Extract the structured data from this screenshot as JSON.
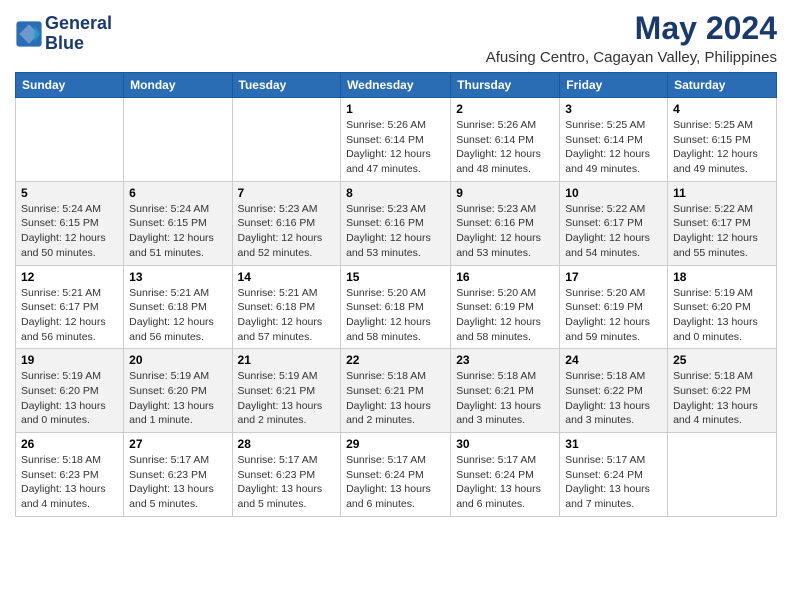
{
  "header": {
    "logo_line1": "General",
    "logo_line2": "Blue",
    "main_title": "May 2024",
    "subtitle": "Afusing Centro, Cagayan Valley, Philippines"
  },
  "weekdays": [
    "Sunday",
    "Monday",
    "Tuesday",
    "Wednesday",
    "Thursday",
    "Friday",
    "Saturday"
  ],
  "weeks": [
    [
      {
        "day": "",
        "content": ""
      },
      {
        "day": "",
        "content": ""
      },
      {
        "day": "",
        "content": ""
      },
      {
        "day": "1",
        "content": "Sunrise: 5:26 AM\nSunset: 6:14 PM\nDaylight: 12 hours\nand 47 minutes."
      },
      {
        "day": "2",
        "content": "Sunrise: 5:26 AM\nSunset: 6:14 PM\nDaylight: 12 hours\nand 48 minutes."
      },
      {
        "day": "3",
        "content": "Sunrise: 5:25 AM\nSunset: 6:14 PM\nDaylight: 12 hours\nand 49 minutes."
      },
      {
        "day": "4",
        "content": "Sunrise: 5:25 AM\nSunset: 6:15 PM\nDaylight: 12 hours\nand 49 minutes."
      }
    ],
    [
      {
        "day": "5",
        "content": "Sunrise: 5:24 AM\nSunset: 6:15 PM\nDaylight: 12 hours\nand 50 minutes."
      },
      {
        "day": "6",
        "content": "Sunrise: 5:24 AM\nSunset: 6:15 PM\nDaylight: 12 hours\nand 51 minutes."
      },
      {
        "day": "7",
        "content": "Sunrise: 5:23 AM\nSunset: 6:16 PM\nDaylight: 12 hours\nand 52 minutes."
      },
      {
        "day": "8",
        "content": "Sunrise: 5:23 AM\nSunset: 6:16 PM\nDaylight: 12 hours\nand 53 minutes."
      },
      {
        "day": "9",
        "content": "Sunrise: 5:23 AM\nSunset: 6:16 PM\nDaylight: 12 hours\nand 53 minutes."
      },
      {
        "day": "10",
        "content": "Sunrise: 5:22 AM\nSunset: 6:17 PM\nDaylight: 12 hours\nand 54 minutes."
      },
      {
        "day": "11",
        "content": "Sunrise: 5:22 AM\nSunset: 6:17 PM\nDaylight: 12 hours\nand 55 minutes."
      }
    ],
    [
      {
        "day": "12",
        "content": "Sunrise: 5:21 AM\nSunset: 6:17 PM\nDaylight: 12 hours\nand 56 minutes."
      },
      {
        "day": "13",
        "content": "Sunrise: 5:21 AM\nSunset: 6:18 PM\nDaylight: 12 hours\nand 56 minutes."
      },
      {
        "day": "14",
        "content": "Sunrise: 5:21 AM\nSunset: 6:18 PM\nDaylight: 12 hours\nand 57 minutes."
      },
      {
        "day": "15",
        "content": "Sunrise: 5:20 AM\nSunset: 6:18 PM\nDaylight: 12 hours\nand 58 minutes."
      },
      {
        "day": "16",
        "content": "Sunrise: 5:20 AM\nSunset: 6:19 PM\nDaylight: 12 hours\nand 58 minutes."
      },
      {
        "day": "17",
        "content": "Sunrise: 5:20 AM\nSunset: 6:19 PM\nDaylight: 12 hours\nand 59 minutes."
      },
      {
        "day": "18",
        "content": "Sunrise: 5:19 AM\nSunset: 6:20 PM\nDaylight: 13 hours\nand 0 minutes."
      }
    ],
    [
      {
        "day": "19",
        "content": "Sunrise: 5:19 AM\nSunset: 6:20 PM\nDaylight: 13 hours\nand 0 minutes."
      },
      {
        "day": "20",
        "content": "Sunrise: 5:19 AM\nSunset: 6:20 PM\nDaylight: 13 hours\nand 1 minute."
      },
      {
        "day": "21",
        "content": "Sunrise: 5:19 AM\nSunset: 6:21 PM\nDaylight: 13 hours\nand 2 minutes."
      },
      {
        "day": "22",
        "content": "Sunrise: 5:18 AM\nSunset: 6:21 PM\nDaylight: 13 hours\nand 2 minutes."
      },
      {
        "day": "23",
        "content": "Sunrise: 5:18 AM\nSunset: 6:21 PM\nDaylight: 13 hours\nand 3 minutes."
      },
      {
        "day": "24",
        "content": "Sunrise: 5:18 AM\nSunset: 6:22 PM\nDaylight: 13 hours\nand 3 minutes."
      },
      {
        "day": "25",
        "content": "Sunrise: 5:18 AM\nSunset: 6:22 PM\nDaylight: 13 hours\nand 4 minutes."
      }
    ],
    [
      {
        "day": "26",
        "content": "Sunrise: 5:18 AM\nSunset: 6:23 PM\nDaylight: 13 hours\nand 4 minutes."
      },
      {
        "day": "27",
        "content": "Sunrise: 5:17 AM\nSunset: 6:23 PM\nDaylight: 13 hours\nand 5 minutes."
      },
      {
        "day": "28",
        "content": "Sunrise: 5:17 AM\nSunset: 6:23 PM\nDaylight: 13 hours\nand 5 minutes."
      },
      {
        "day": "29",
        "content": "Sunrise: 5:17 AM\nSunset: 6:24 PM\nDaylight: 13 hours\nand 6 minutes."
      },
      {
        "day": "30",
        "content": "Sunrise: 5:17 AM\nSunset: 6:24 PM\nDaylight: 13 hours\nand 6 minutes."
      },
      {
        "day": "31",
        "content": "Sunrise: 5:17 AM\nSunset: 6:24 PM\nDaylight: 13 hours\nand 7 minutes."
      },
      {
        "day": "",
        "content": ""
      }
    ]
  ]
}
